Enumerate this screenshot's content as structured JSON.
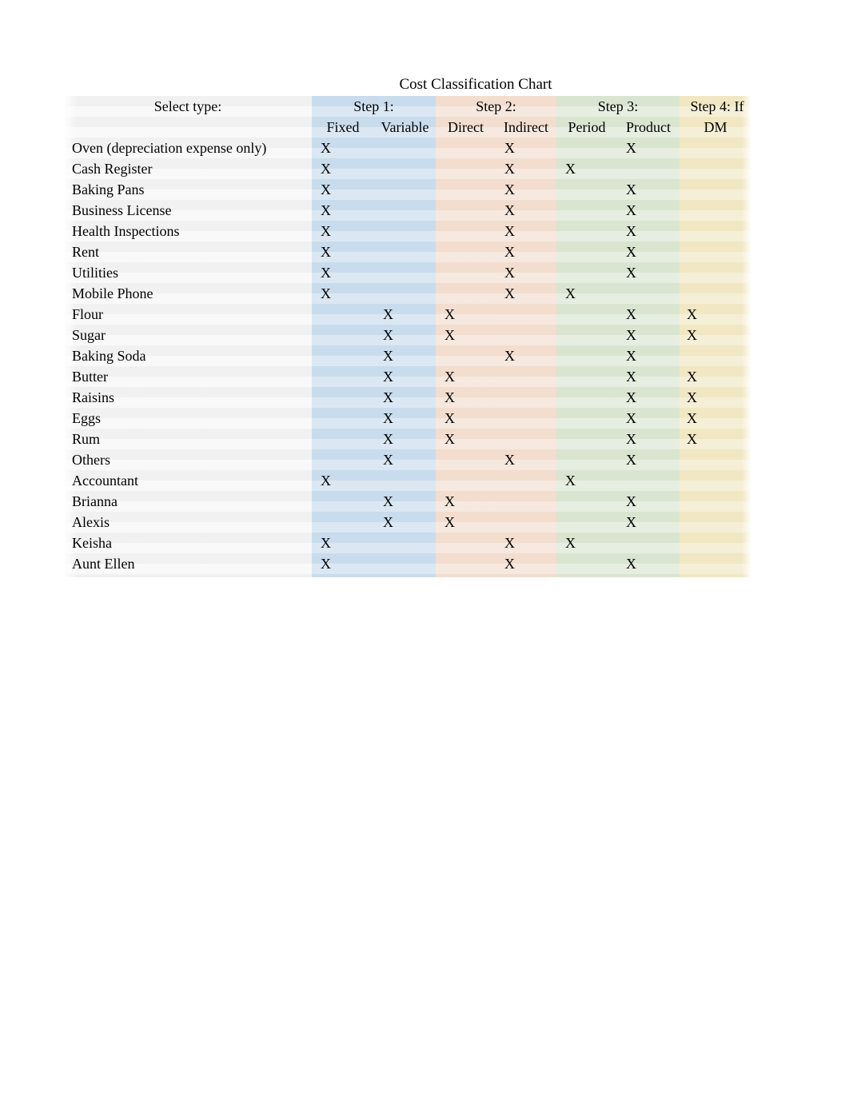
{
  "title": "Cost Classification Chart",
  "table": {
    "label_header": "Select type:",
    "groups": [
      {
        "name": "Step 1:",
        "color": "#c9dced"
      },
      {
        "name": "Step 2:",
        "color": "#f2ddcf"
      },
      {
        "name": "Step 3:",
        "color": "#d9e5d1"
      },
      {
        "name": "Step 4:  If",
        "color": "#f1e7c2"
      }
    ],
    "columns": [
      "Fixed",
      "Variable",
      "Direct",
      "Indirect",
      "Period",
      "Product",
      "DM"
    ],
    "mark": "X",
    "rows": [
      {
        "label": "Oven (depreciation expense only)",
        "fixed": "X",
        "variable": "",
        "direct": "",
        "indirect": "X",
        "period": "",
        "product": "X",
        "dm": ""
      },
      {
        "label": "Cash Register",
        "fixed": "X",
        "variable": "",
        "direct": "",
        "indirect": "X",
        "period": "X",
        "product": "",
        "dm": ""
      },
      {
        "label": "Baking Pans",
        "fixed": "X",
        "variable": "",
        "direct": "",
        "indirect": "X",
        "period": "",
        "product": "X",
        "dm": ""
      },
      {
        "label": "Business License",
        "fixed": "X",
        "variable": "",
        "direct": "",
        "indirect": "X",
        "period": "",
        "product": "X",
        "dm": ""
      },
      {
        "label": "Health Inspections",
        "fixed": "X",
        "variable": "",
        "direct": "",
        "indirect": "X",
        "period": "",
        "product": "X",
        "dm": ""
      },
      {
        "label": "Rent",
        "fixed": "X",
        "variable": "",
        "direct": "",
        "indirect": "X",
        "period": "",
        "product": "X",
        "dm": ""
      },
      {
        "label": "Utilities",
        "fixed": "X",
        "variable": "",
        "direct": "",
        "indirect": "X",
        "period": "",
        "product": "X",
        "dm": ""
      },
      {
        "label": "Mobile Phone",
        "fixed": "X",
        "variable": "",
        "direct": "",
        "indirect": "X",
        "period": "X",
        "product": "",
        "dm": ""
      },
      {
        "label": "Flour",
        "fixed": "",
        "variable": "X",
        "direct": "X",
        "indirect": "",
        "period": "",
        "product": "X",
        "dm": "X"
      },
      {
        "label": "Sugar",
        "fixed": "",
        "variable": "X",
        "direct": "X",
        "indirect": "",
        "period": "",
        "product": "X",
        "dm": "X"
      },
      {
        "label": "Baking Soda",
        "fixed": "",
        "variable": "X",
        "direct": "",
        "indirect": "X",
        "period": "",
        "product": "X",
        "dm": ""
      },
      {
        "label": "Butter",
        "fixed": "",
        "variable": "X",
        "direct": "X",
        "indirect": "",
        "period": "",
        "product": "X",
        "dm": "X"
      },
      {
        "label": "Raisins",
        "fixed": "",
        "variable": "X",
        "direct": "X",
        "indirect": "",
        "period": "",
        "product": "X",
        "dm": "X"
      },
      {
        "label": "Eggs",
        "fixed": "",
        "variable": "X",
        "direct": "X",
        "indirect": "",
        "period": "",
        "product": "X",
        "dm": "X"
      },
      {
        "label": "Rum",
        "fixed": "",
        "variable": "X",
        "direct": "X",
        "indirect": "",
        "period": "",
        "product": "X",
        "dm": "X"
      },
      {
        "label": "Others",
        "fixed": "",
        "variable": "X",
        "direct": "",
        "indirect": "X",
        "period": "",
        "product": "X",
        "dm": ""
      },
      {
        "label": "Accountant",
        "fixed": "X",
        "variable": "",
        "direct": "",
        "indirect": "",
        "period": "X",
        "product": "",
        "dm": ""
      },
      {
        "label": "Brianna",
        "fixed": "",
        "variable": "X",
        "direct": "X",
        "indirect": "",
        "period": "",
        "product": "X",
        "dm": ""
      },
      {
        "label": "Alexis",
        "fixed": "",
        "variable": "X",
        "direct": "X",
        "indirect": "",
        "period": "",
        "product": "X",
        "dm": ""
      },
      {
        "label": "Keisha",
        "fixed": "X",
        "variable": "",
        "direct": "",
        "indirect": "X",
        "period": "X",
        "product": "",
        "dm": ""
      },
      {
        "label": "Aunt Ellen",
        "fixed": "X",
        "variable": "",
        "direct": "",
        "indirect": "X",
        "period": "",
        "product": "X",
        "dm": ""
      }
    ]
  }
}
